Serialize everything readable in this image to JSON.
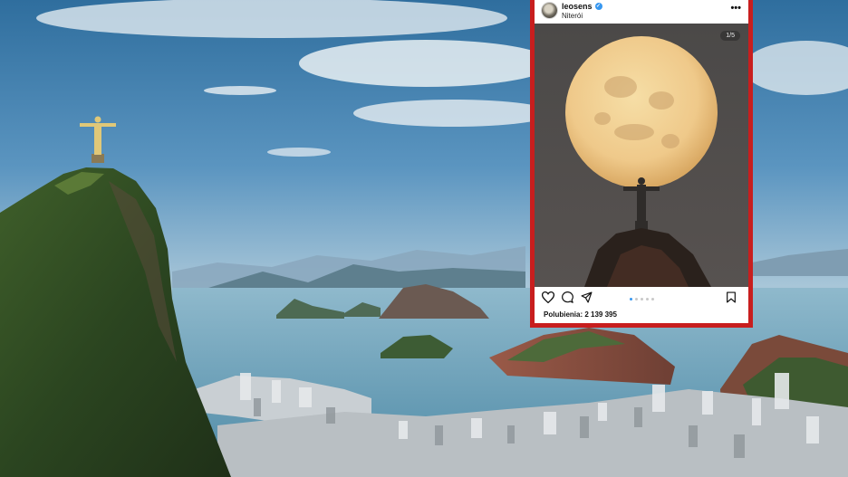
{
  "post": {
    "username": "leosens",
    "location": "Niterói",
    "slide_counter": "1/5",
    "likes_text": "Polubienia: 2 139 395",
    "carousel": {
      "total_slides": 5,
      "current_slide": 1
    }
  },
  "icons": {
    "verified": "verified-badge-icon",
    "more": "more-options-icon",
    "like": "heart-icon",
    "comment": "comment-icon",
    "share": "send-icon",
    "save": "bookmark-icon"
  },
  "colors": {
    "frame": "#c81e1e",
    "verified": "#3797f0",
    "moon": "#f1cf8c",
    "sky": "#6a9cc4",
    "sea": "#5f97b2"
  }
}
